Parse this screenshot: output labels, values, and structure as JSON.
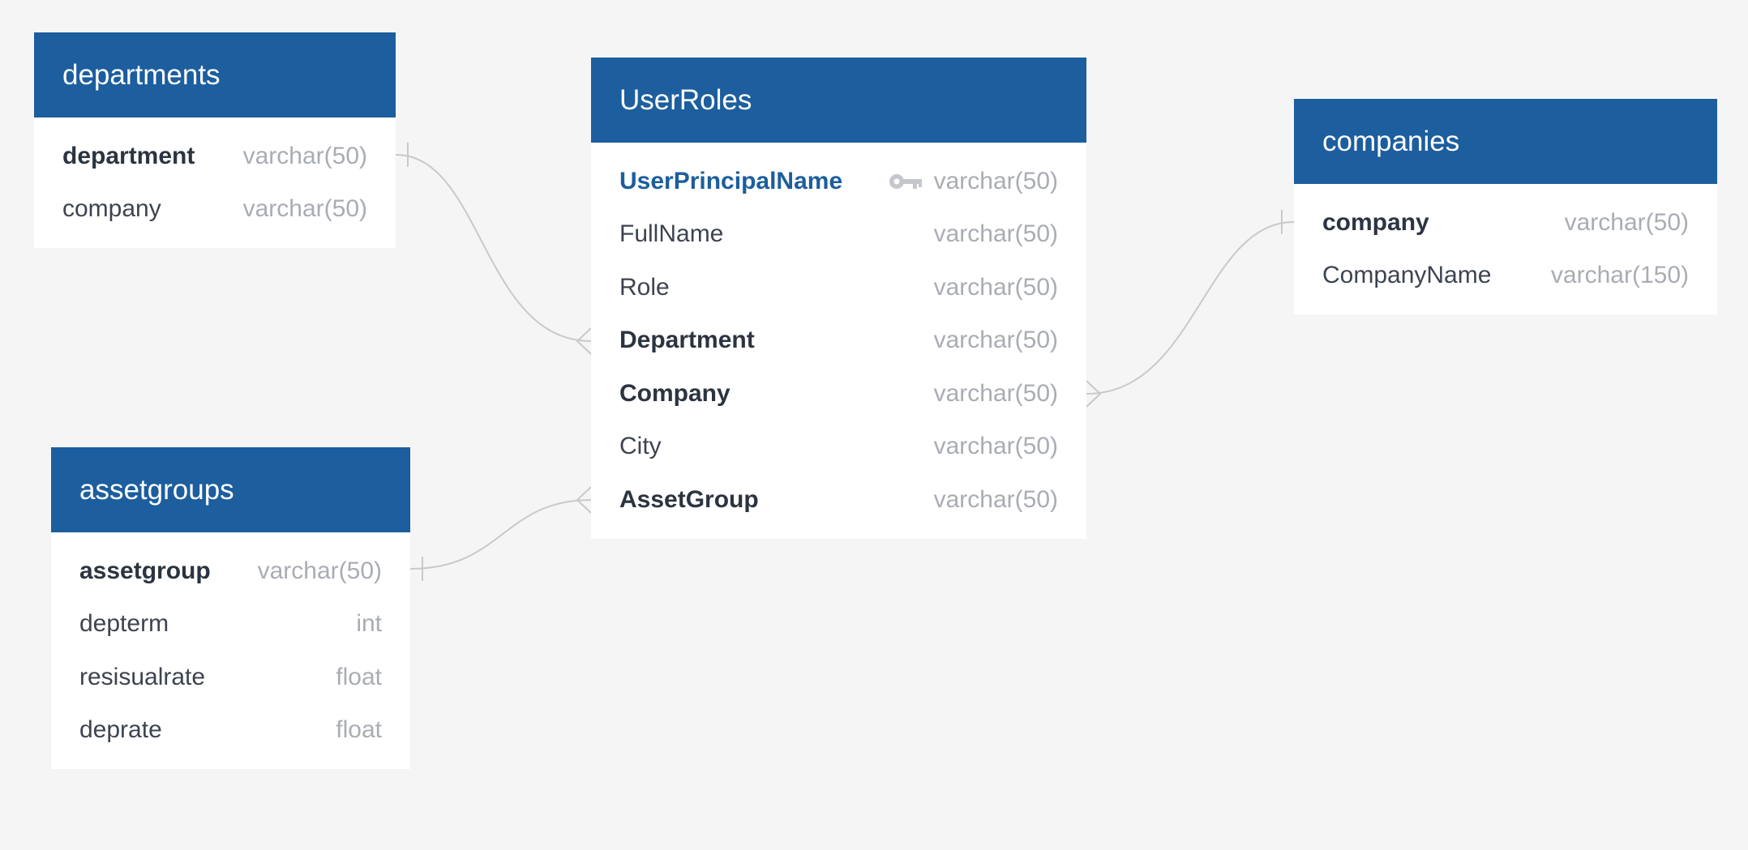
{
  "tables": [
    {
      "id": "departments",
      "name": "departments",
      "columns": [
        {
          "name": "department",
          "type": "varchar(50)",
          "style": "bold"
        },
        {
          "name": "company",
          "type": "varchar(50)",
          "style": "normal"
        }
      ]
    },
    {
      "id": "userroles",
      "name": "UserRoles",
      "columns": [
        {
          "name": "UserPrincipalName",
          "type": "varchar(50)",
          "style": "pk",
          "icon": "key-icon"
        },
        {
          "name": "FullName",
          "type": "varchar(50)",
          "style": "normal"
        },
        {
          "name": "Role",
          "type": "varchar(50)",
          "style": "normal"
        },
        {
          "name": "Department",
          "type": "varchar(50)",
          "style": "bold"
        },
        {
          "name": "Company",
          "type": "varchar(50)",
          "style": "bold"
        },
        {
          "name": "City",
          "type": "varchar(50)",
          "style": "normal"
        },
        {
          "name": "AssetGroup",
          "type": "varchar(50)",
          "style": "bold"
        }
      ]
    },
    {
      "id": "companies",
      "name": "companies",
      "columns": [
        {
          "name": "company",
          "type": "varchar(50)",
          "style": "bold"
        },
        {
          "name": "CompanyName",
          "type": "varchar(150)",
          "style": "normal"
        }
      ]
    },
    {
      "id": "assetgroups",
      "name": "assetgroups",
      "columns": [
        {
          "name": "assetgroup",
          "type": "varchar(50)",
          "style": "bold"
        },
        {
          "name": "depterm",
          "type": "int",
          "style": "normal"
        },
        {
          "name": "resisualrate",
          "type": "float",
          "style": "normal"
        },
        {
          "name": "deprate",
          "type": "float",
          "style": "normal"
        }
      ]
    }
  ],
  "relationships": [
    {
      "from": "departments.department",
      "to": "UserRoles.Department",
      "from_cardinality": "one",
      "to_cardinality": "many"
    },
    {
      "from": "companies.company",
      "to": "UserRoles.Company",
      "from_cardinality": "one",
      "to_cardinality": "many"
    },
    {
      "from": "assetgroups.assetgroup",
      "to": "UserRoles.AssetGroup",
      "from_cardinality": "one",
      "to_cardinality": "many"
    }
  ],
  "colors": {
    "header": "#1c5e9e",
    "background": "#f5f5f5",
    "link": "#c9c9c9",
    "primary_key": "#1c5e9e",
    "type_text": "#a9adb3"
  }
}
